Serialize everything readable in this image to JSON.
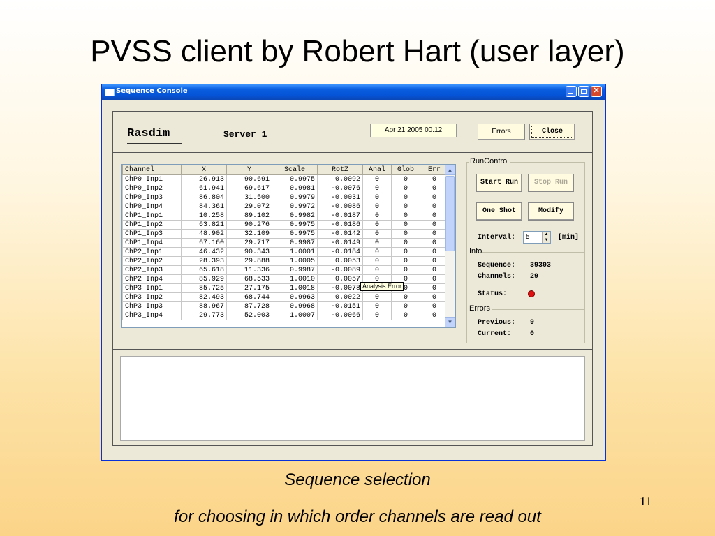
{
  "slide": {
    "title": "PVSS client by Robert Hart (user layer)",
    "caption_line1": "Sequence selection",
    "caption_line2": "for choosing in which order channels are read out",
    "page_number": "11"
  },
  "window": {
    "title": "Sequence Console",
    "close_glyph": "✕"
  },
  "header": {
    "name": "Rasdim",
    "server": "Server 1",
    "date": "Apr 21 2005   00.12",
    "errors_button": "Errors",
    "close_button": "Close"
  },
  "table": {
    "columns": [
      "Channel",
      "X",
      "Y",
      "Scale",
      "RotZ",
      "Anal",
      "Glob",
      "Err"
    ],
    "rows": [
      [
        "ChP0_Inp1",
        "26.913",
        "90.691",
        "0.9975",
        "0.0092",
        "0",
        "0",
        "0"
      ],
      [
        "ChP0_Inp2",
        "61.941",
        "69.617",
        "0.9981",
        "-0.0076",
        "0",
        "0",
        "0"
      ],
      [
        "ChP0_Inp3",
        "86.804",
        "31.500",
        "0.9979",
        "-0.0031",
        "0",
        "0",
        "0"
      ],
      [
        "ChP0_Inp4",
        "84.361",
        "29.072",
        "0.9972",
        "-0.0086",
        "0",
        "0",
        "0"
      ],
      [
        "ChP1_Inp1",
        "10.258",
        "89.102",
        "0.9982",
        "-0.0187",
        "0",
        "0",
        "0"
      ],
      [
        "ChP1_Inp2",
        "63.821",
        "90.276",
        "0.9975",
        "-0.0186",
        "0",
        "0",
        "0"
      ],
      [
        "ChP1_Inp3",
        "48.902",
        "32.109",
        "0.9975",
        "-0.0142",
        "0",
        "0",
        "0"
      ],
      [
        "ChP1_Inp4",
        "67.160",
        "29.717",
        "0.9987",
        "-0.0149",
        "0",
        "0",
        "0"
      ],
      [
        "ChP2_Inp1",
        "46.432",
        "90.343",
        "1.0001",
        "-0.0184",
        "0",
        "0",
        "0"
      ],
      [
        "ChP2_Inp2",
        "28.393",
        "29.888",
        "1.0005",
        "0.0053",
        "0",
        "0",
        "0"
      ],
      [
        "ChP2_Inp3",
        "65.618",
        "11.336",
        "0.9987",
        "-0.0089",
        "0",
        "0",
        "0"
      ],
      [
        "ChP2_Inp4",
        "85.929",
        "68.533",
        "1.0010",
        "0.0057",
        "0",
        "0",
        "0"
      ],
      [
        "ChP3_Inp1",
        "85.725",
        "27.175",
        "1.0018",
        "-0.0078",
        "0",
        "0",
        "0"
      ],
      [
        "ChP3_Inp2",
        "82.493",
        "68.744",
        "0.9963",
        "0.0022",
        "0",
        "0",
        "0"
      ],
      [
        "ChP3_Inp3",
        "88.967",
        "87.728",
        "0.9968",
        "-0.0151",
        "0",
        "0",
        "0"
      ],
      [
        "ChP3_Inp4",
        "29.773",
        "52.003",
        "1.0007",
        "-0.0066",
        "0",
        "0",
        "0"
      ]
    ],
    "tooltip": "Analysis Error"
  },
  "run_control": {
    "label": "RunControl",
    "start_run": "Start Run",
    "stop_run": "Stop Run",
    "one_shot": "One Shot",
    "modify": "Modify",
    "interval_label": "Interval:",
    "interval_value": "5",
    "interval_unit": "[min]"
  },
  "info": {
    "label": "Info",
    "sequence_label": "Sequence:",
    "sequence_value": "39303",
    "channels_label": "Channels:",
    "channels_value": "29",
    "status_label": "Status:",
    "status_color": "#e01010"
  },
  "errors": {
    "label": "Errors",
    "previous_label": "Previous:",
    "previous_value": "9",
    "current_label": "Current:",
    "current_value": "0"
  }
}
